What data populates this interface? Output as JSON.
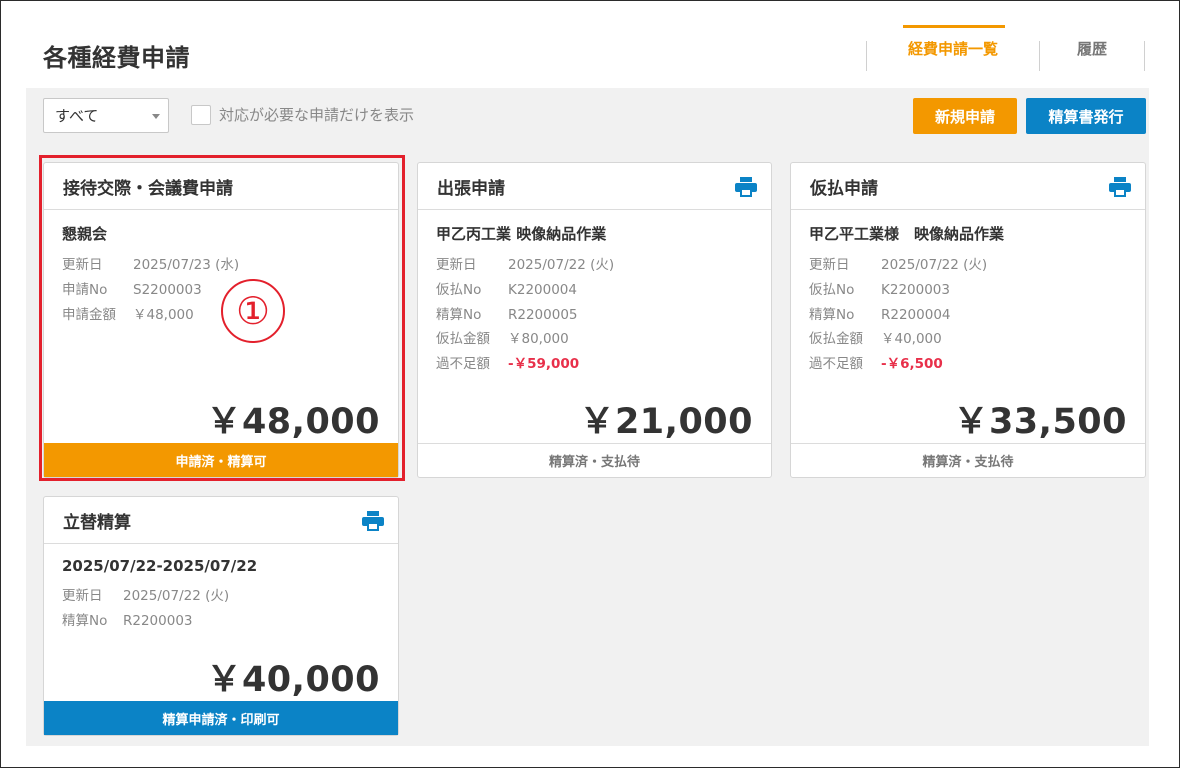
{
  "page": {
    "title": "各種経費申請"
  },
  "tabs": {
    "list": "経費申請一覧",
    "history": "履歴"
  },
  "toolbar": {
    "filter_value": "すべて",
    "checkbox_label": "対応が必要な申請だけを表示",
    "new_button": "新規申請",
    "issue_button": "精算書発行"
  },
  "cards": [
    {
      "title": "接待交際・会議費申請",
      "subject": "懇親会",
      "rows": [
        {
          "label": "更新日",
          "value": "2025/07/23 (水)"
        },
        {
          "label": "申請No",
          "value": "S2200003"
        },
        {
          "label": "申請金額",
          "value": "￥48,000"
        }
      ],
      "amount": "￥48,000",
      "status": "申請済・精算可",
      "status_color": "#f39800",
      "printable": false
    },
    {
      "title": "出張申請",
      "subject": "甲乙丙工業 映像納品作業",
      "rows": [
        {
          "label": "更新日",
          "value": "2025/07/22 (火)"
        },
        {
          "label": "仮払No",
          "value": "K2200004"
        },
        {
          "label": "精算No",
          "value": "R2200005"
        },
        {
          "label": "仮払金額",
          "value": "￥80,000"
        },
        {
          "label": "過不足額",
          "value": "-￥59,000"
        }
      ],
      "amount": "￥21,000",
      "status": "精算済・支払待",
      "printable": true
    },
    {
      "title": "仮払申請",
      "subject": "甲乙平工業様　映像納品作業",
      "rows": [
        {
          "label": "更新日",
          "value": "2025/07/22 (火)"
        },
        {
          "label": "仮払No",
          "value": "K2200003"
        },
        {
          "label": "精算No",
          "value": "R2200004"
        },
        {
          "label": "仮払金額",
          "value": "￥40,000"
        },
        {
          "label": "過不足額",
          "value": "-￥6,500"
        }
      ],
      "amount": "￥33,500",
      "status": "精算済・支払待",
      "printable": true
    },
    {
      "title": "立替精算",
      "subject": "2025/07/22-2025/07/22",
      "rows": [
        {
          "label": "更新日",
          "value": "2025/07/22 (火)"
        },
        {
          "label": "精算No",
          "value": "R2200003"
        }
      ],
      "amount": "￥40,000",
      "status": "精算申請済・印刷可",
      "status_color": "#0b83c6",
      "printable": true
    }
  ],
  "annotation": {
    "marker": "①",
    "color": "#e3202c"
  },
  "colors": {
    "accent_orange": "#f39800",
    "accent_blue": "#0b83c6",
    "negative_red": "#e8304a"
  }
}
